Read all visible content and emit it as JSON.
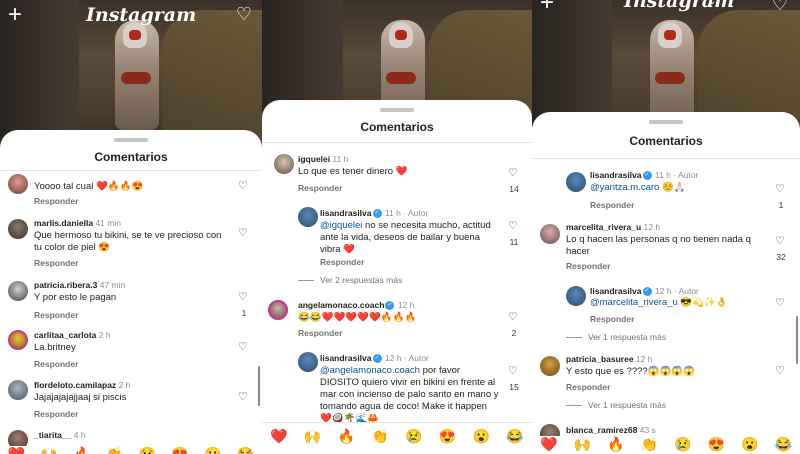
{
  "app": {
    "name": "Instagram"
  },
  "sheet_title": "Comentarios",
  "reply_label": "Responder",
  "author_label": "Autor",
  "emoji_bar": [
    "❤️",
    "🙌",
    "🔥",
    "👏",
    "😢",
    "😍",
    "😮",
    "😂"
  ],
  "panel1": {
    "comments": [
      {
        "user": "",
        "time": "",
        "text": "Yoooo tal cual ❤️🔥🔥😍",
        "likes": ""
      },
      {
        "user": "marlis.daniella",
        "time": "41 min",
        "text": "Que hermoso tu bikini, se te ve precioso con tu color de piel 😍",
        "likes": ""
      },
      {
        "user": "patricia.ribera.3",
        "time": "47 min",
        "text": "Y por esto le pagan",
        "likes": "1"
      },
      {
        "user": "carlitaa_carlota",
        "time": "2 h",
        "text": "La.britney",
        "likes": ""
      },
      {
        "user": "flordeloto.camilapaz",
        "time": "2 h",
        "text": "Jajajajajajjaaj si piscis",
        "likes": ""
      },
      {
        "user": "_tiarita__",
        "time": "4 h",
        "text": "",
        "likes": ""
      }
    ]
  },
  "panel2": {
    "comments": [
      {
        "user": "igquelei",
        "time": "11 h",
        "text": "Lo que es tener dinero ❤️",
        "likes": "14"
      },
      {
        "user": "lisandrasilva",
        "time": "11 h",
        "mention": "@igquelei",
        "text": " no se necesita mucho, actitud ante la vida, deseos de bailar y buena vibra ❤️",
        "likes": "11"
      },
      {
        "user": "angelamonaco.coach",
        "time": "12 h",
        "text": "😂😂❤️❤️❤️❤️❤️🔥🔥🔥",
        "likes": "2"
      },
      {
        "user": "lisandrasilva",
        "time": "12 h",
        "mention": "@angelamonaco.coach",
        "text": " por favor DIOSITO quiero vivir en bikini en frente al mar con incienso de palo santo en mano y tomando agua de coco! Make it happen ❤️🥥🌴🌊🦀",
        "likes": "15"
      }
    ],
    "view_more": "Ver 2 respuestas más"
  },
  "panel3": {
    "comments": [
      {
        "user": "lisandrasilva",
        "time": "11 h",
        "mention": "@yaritza.m.caro",
        "text": " ☺️🙏🏻",
        "likes": "1"
      },
      {
        "user": "marcelita_rivera_u",
        "time": "12 h",
        "text": "Lo q hacen las personas q no tienen nada q hacer",
        "likes": "32"
      },
      {
        "user": "lisandrasilva",
        "time": "12 h",
        "mention": "@marcelita_rivera_u",
        "text": " 😎💫✨👌",
        "likes": ""
      },
      {
        "user": "patricia_basuree",
        "time": "12 h",
        "text": "Y esto que es ????😱😱😱😱",
        "likes": ""
      },
      {
        "user": "blanca_ramirez68",
        "time": "43 s",
        "text": "",
        "likes": ""
      }
    ],
    "view_more_1": "Ver 1 respuesta más",
    "view_more_2": "Ver 1 respuesta más"
  }
}
